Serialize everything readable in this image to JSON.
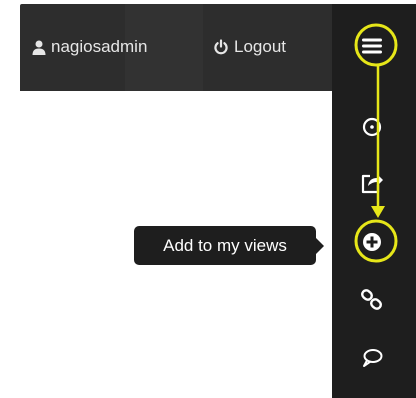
{
  "header": {
    "user_name": "nagiosadmin",
    "logout_label": "Logout",
    "user_icon": "user-icon",
    "logout_icon": "power-icon"
  },
  "sidebar": {
    "buttons": [
      {
        "name": "menu",
        "icon": "hamburger-menu-icon"
      },
      {
        "name": "info",
        "icon": "info-circle-icon"
      },
      {
        "name": "share",
        "icon": "share-icon"
      },
      {
        "name": "add-to-my-views",
        "icon": "plus-circle-icon"
      },
      {
        "name": "link",
        "icon": "link-icon"
      },
      {
        "name": "comment",
        "icon": "comment-icon"
      }
    ]
  },
  "tooltip": {
    "text": "Add to my views"
  },
  "colors": {
    "header_bg": "#2d2d2d",
    "sidebar_bg": "#1e1e1e",
    "icon": "#ffffff",
    "highlight": "#e6e619"
  }
}
